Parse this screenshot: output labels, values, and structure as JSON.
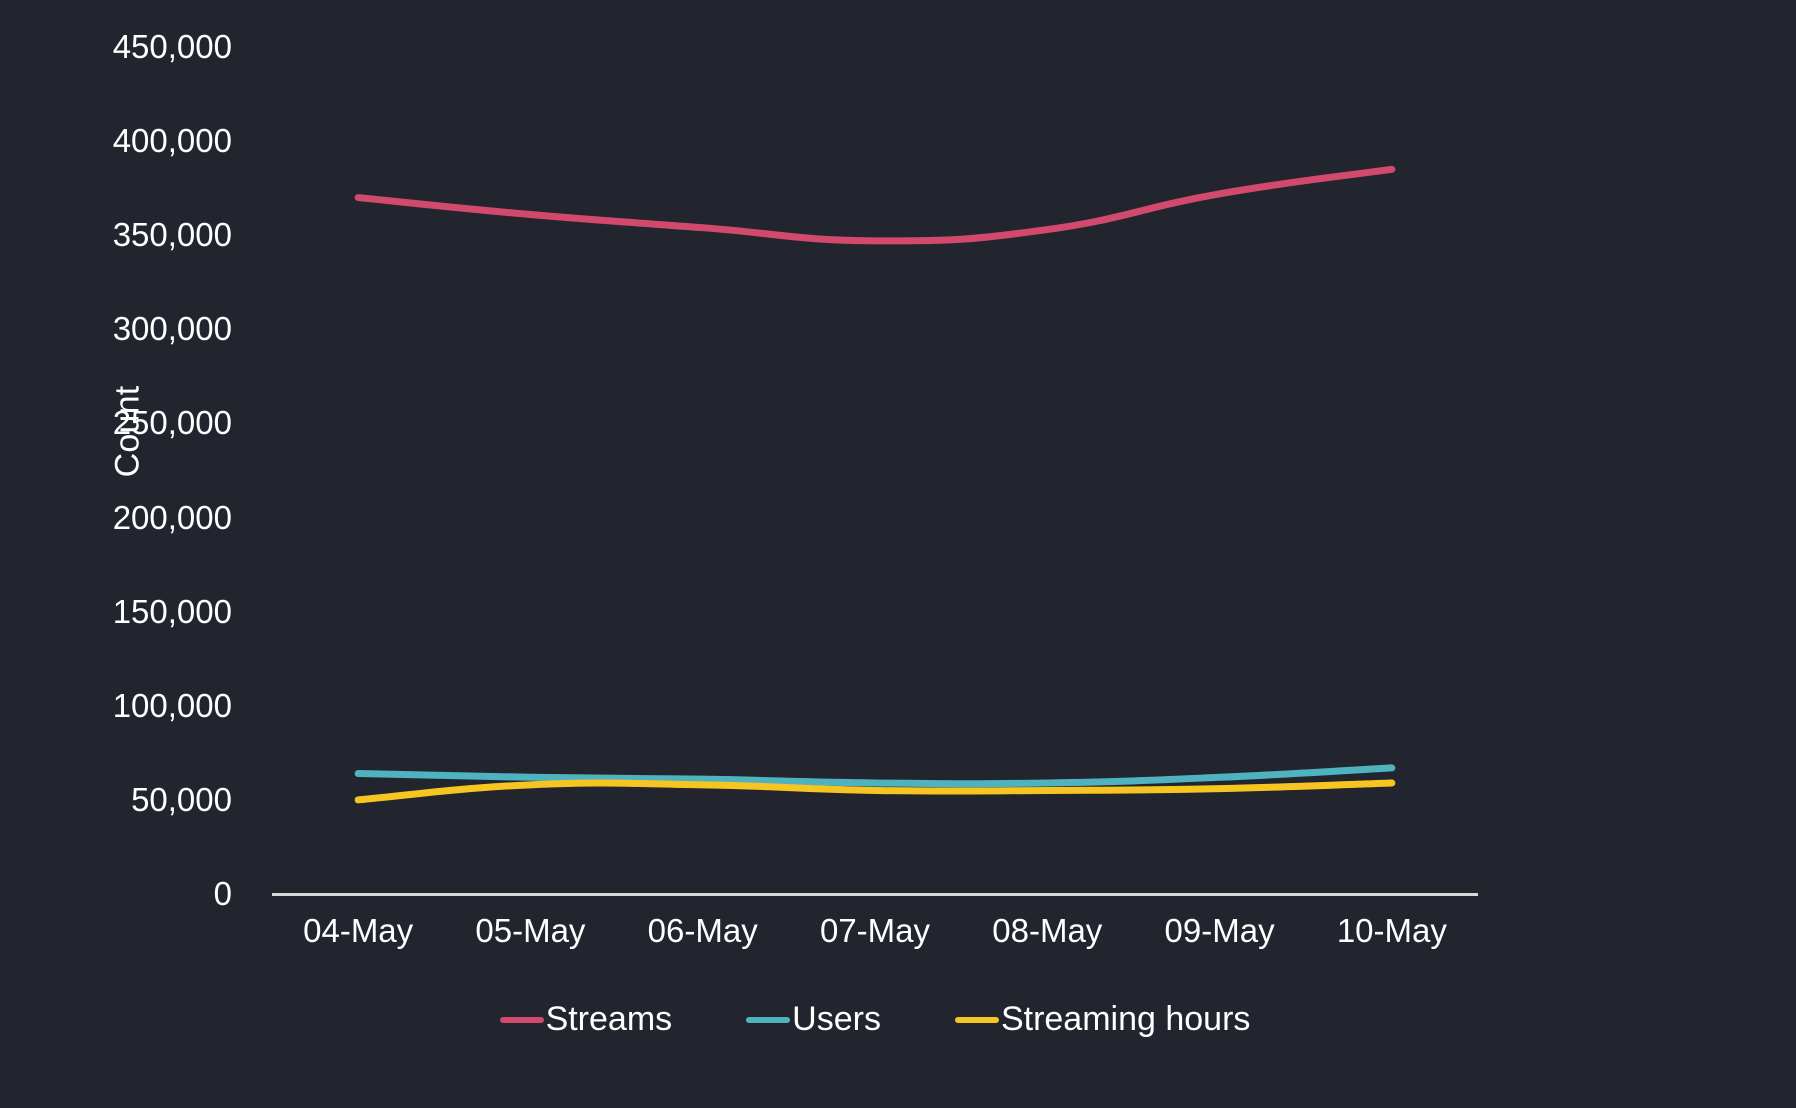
{
  "chart_data": {
    "type": "line",
    "title": "",
    "xlabel": "",
    "ylabel": "Count",
    "categories": [
      "04-May",
      "05-May",
      "06-May",
      "07-May",
      "08-May",
      "09-May",
      "10-May"
    ],
    "ylim": [
      0,
      450000
    ],
    "ytick_values": [
      0,
      50000,
      100000,
      150000,
      200000,
      250000,
      300000,
      350000,
      400000,
      450000
    ],
    "ytick_labels": [
      "0",
      "50,000",
      "100,000",
      "150,000",
      "200,000",
      "250,000",
      "300,000",
      "350,000",
      "400,000",
      "450,000"
    ],
    "grid": false,
    "legend_position": "bottom",
    "background_color": "#22252e",
    "axis_color": "#d8d8d8",
    "text_color": "#ffffff",
    "series": [
      {
        "name": "Streams",
        "color": "#d2496e",
        "values": [
          370000,
          361000,
          354000,
          347000,
          353000,
          372000,
          385000
        ]
      },
      {
        "name": "Users",
        "color": "#4fb3bf",
        "values": [
          64000,
          62000,
          61000,
          59000,
          59000,
          62000,
          67000
        ]
      },
      {
        "name": "Streaming hours",
        "color": "#f7c522",
        "values": [
          50000,
          58000,
          58000,
          55000,
          55000,
          56000,
          59000
        ]
      }
    ]
  },
  "axis": {
    "y_title": "Count"
  },
  "legend": {
    "items": [
      {
        "label": "Streams",
        "color": "#d2496e"
      },
      {
        "label": "Users",
        "color": "#4fb3bf"
      },
      {
        "label": "Streaming hours",
        "color": "#f7c522"
      }
    ]
  }
}
